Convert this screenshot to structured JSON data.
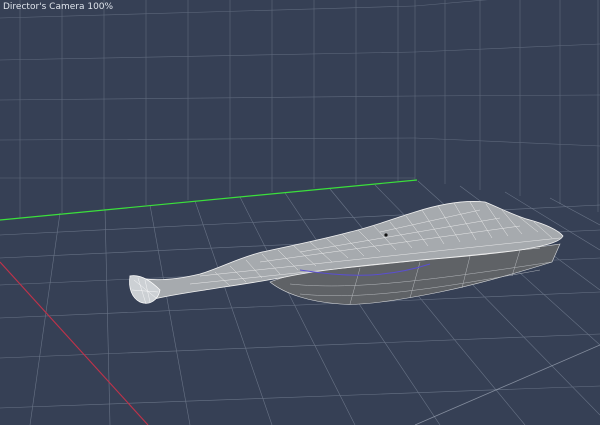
{
  "viewport": {
    "camera_label": "Director's Camera 100%",
    "colors": {
      "background": "#364055",
      "grid_line": "#7f8a9c",
      "x_axis": "#3be03b",
      "z_axis": "#c0324a",
      "mesh_fill": "#9fa3a8",
      "mesh_wire": "#f2f2f2",
      "mesh_dark": "#5f6266",
      "mesh_edge_highlight": "#5a4fd0"
    }
  }
}
